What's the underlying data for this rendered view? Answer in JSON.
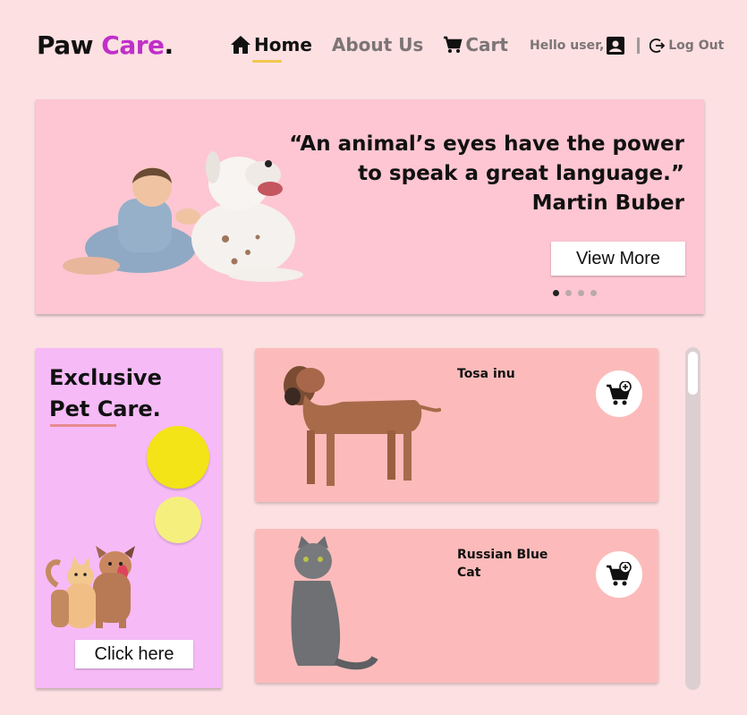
{
  "header": {
    "logo_primary": "Paw",
    "logo_accent": "Care",
    "logo_dot": ".",
    "nav": [
      {
        "label": "Home",
        "icon": "home-icon",
        "active": true
      },
      {
        "label": "About Us",
        "active": false
      },
      {
        "label": "Cart",
        "icon": "cart-icon",
        "active": false
      }
    ],
    "greeting": "Hello user,",
    "logout_label": "Log Out"
  },
  "hero": {
    "quote_line": "“An animal’s eyes have the power to speak a great language.”",
    "author": "Martin Buber",
    "button_label": "View More",
    "slide_count": 4,
    "active_slide": 1
  },
  "promo": {
    "title_line1": "Exclusive",
    "title_line2": "Pet Care.",
    "button_label": "Click here"
  },
  "products": [
    {
      "name": "Tosa inu",
      "image": "dog-image",
      "action_icon": "add-to-cart-icon"
    },
    {
      "name": "Russian Blue Cat",
      "image": "cat-image",
      "action_icon": "add-to-cart-icon"
    }
  ],
  "colors": {
    "background": "#fde0e2",
    "brand_accent": "#c02fc9",
    "hero_bg": "#fdc6d2",
    "promo_bg": "#f6baf7",
    "card_bg": "#fcbbba",
    "nav_underline": "#f2c84b"
  }
}
